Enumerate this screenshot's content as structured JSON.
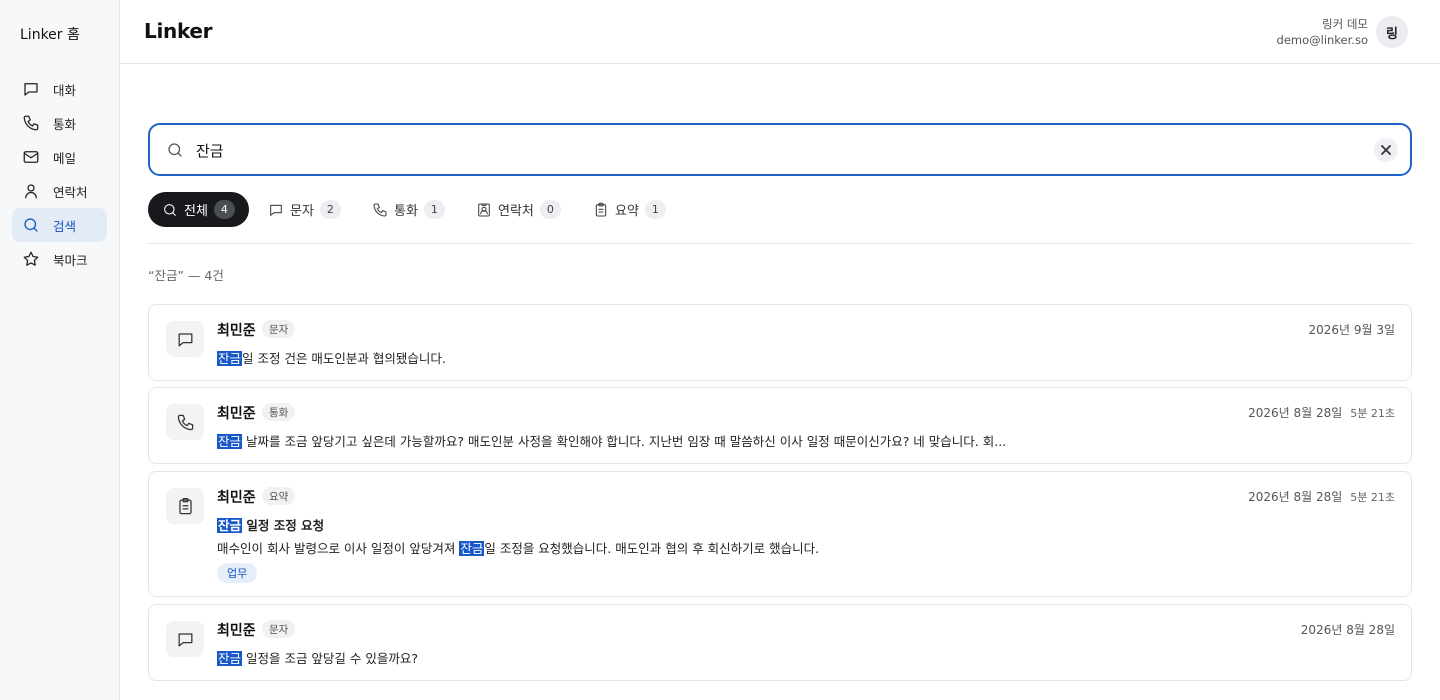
{
  "sidebar": {
    "home": "Linker 홈",
    "items": [
      {
        "label": "대화",
        "icon": "message-icon"
      },
      {
        "label": "통화",
        "icon": "phone-icon"
      },
      {
        "label": "메일",
        "icon": "mail-icon"
      },
      {
        "label": "연락처",
        "icon": "user-icon"
      },
      {
        "label": "검색",
        "icon": "search-icon",
        "active": true
      },
      {
        "label": "북마크",
        "icon": "star-icon"
      }
    ]
  },
  "header": {
    "brand": "Linker",
    "user_name": "링커 데모",
    "user_email": "demo@linker.so",
    "avatar": "링"
  },
  "search": {
    "value": "잔금"
  },
  "tabs": [
    {
      "label": "전체",
      "count": "4",
      "icon": "search-icon",
      "active": true
    },
    {
      "label": "문자",
      "count": "2",
      "icon": "message-icon"
    },
    {
      "label": "통화",
      "count": "1",
      "icon": "phone-icon"
    },
    {
      "label": "연락처",
      "count": "0",
      "icon": "contact-icon"
    },
    {
      "label": "요약",
      "count": "1",
      "icon": "clipboard-icon"
    }
  ],
  "summary": "“잔금” — 4건",
  "highlight_color": "#1858c8",
  "accent_color": "#1f63c6",
  "results": [
    {
      "icon": "message-icon",
      "name": "최민준",
      "type": "문자",
      "date": "2026년 9월 3일",
      "line_hl": "잔금",
      "line_rest": "일 조정 건은 매도인분과 협의됐습니다."
    },
    {
      "icon": "phone-icon",
      "name": "최민준",
      "type": "통화",
      "date": "2026년 8월 28일",
      "duration": "5분 21초",
      "line_hl": "잔금",
      "line_rest": " 날짜를 조금 앞당기고 싶은데 가능할까요? 매도인분 사정을 확인해야 합니다. 지난번 임장 때 말씀하신 이사 일정 때문이신가요? 네 맞습니다. 회..."
    },
    {
      "icon": "clipboard-icon",
      "name": "최민준",
      "type": "요약",
      "date": "2026년 8월 28일",
      "duration": "5분 21초",
      "title_hl": "잔금",
      "title_rest": " 일정 조정 요청",
      "body_pre": "매수인이 회사 발령으로 이사 일정이 앞당겨져 ",
      "body_hl": "잔금",
      "body_post": "일 조정을 요청했습니다. 매도인과 협의 후 회신하기로 했습니다.",
      "tag": "업무"
    },
    {
      "icon": "message-icon",
      "name": "최민준",
      "type": "문자",
      "date": "2026년 8월 28일",
      "line_hl": "잔금",
      "line_rest": " 일정을 조금 앞당길 수 있을까요?"
    }
  ]
}
